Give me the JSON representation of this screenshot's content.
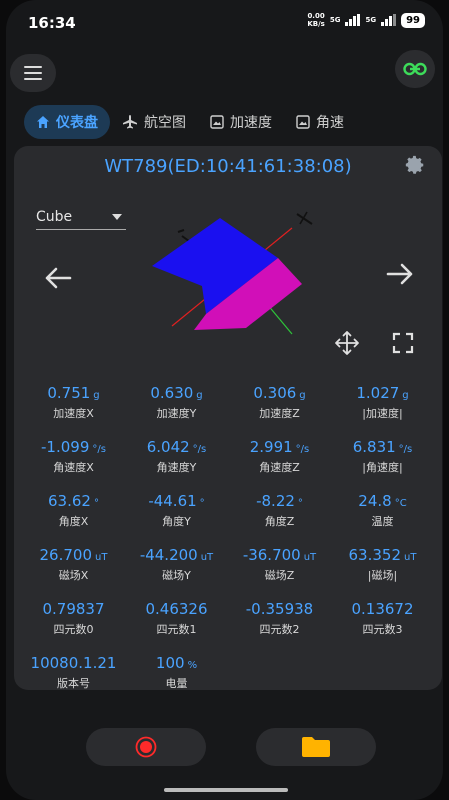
{
  "status": {
    "time": "16:34",
    "speed": "0.00",
    "speed_unit": "KB/s",
    "sig1": "5G",
    "sig2": "5G",
    "battery": "99"
  },
  "tabs": [
    {
      "label": "仪表盘",
      "icon": "home-icon",
      "active": true
    },
    {
      "label": "航空图",
      "icon": "airplane-icon",
      "active": false
    },
    {
      "label": "加速度",
      "icon": "image-icon",
      "active": false
    },
    {
      "label": "角速",
      "icon": "image-icon",
      "active": false
    }
  ],
  "device": {
    "title": "WT789(ED:10:41:61:38:08)"
  },
  "view_select": {
    "value": "Cube"
  },
  "colors": {
    "accent": "#4aa3ff",
    "cube_top": "#1a10f0",
    "cube_side": "#d10fb8",
    "record": "#ff2a2a",
    "folder": "#ffb300"
  },
  "readings": [
    {
      "value": "0.751",
      "unit": "g",
      "label": "加速度X"
    },
    {
      "value": "0.630",
      "unit": "g",
      "label": "加速度Y"
    },
    {
      "value": "0.306",
      "unit": "g",
      "label": "加速度Z"
    },
    {
      "value": "1.027",
      "unit": "g",
      "label": "|加速度|"
    },
    {
      "value": "-1.099",
      "unit": "°/s",
      "label": "角速度X"
    },
    {
      "value": "6.042",
      "unit": "°/s",
      "label": "角速度Y"
    },
    {
      "value": "2.991",
      "unit": "°/s",
      "label": "角速度Z"
    },
    {
      "value": "6.831",
      "unit": "°/s",
      "label": "|角速度|"
    },
    {
      "value": "63.62",
      "unit": "°",
      "label": "角度X"
    },
    {
      "value": "-44.61",
      "unit": "°",
      "label": "角度Y"
    },
    {
      "value": "-8.22",
      "unit": "°",
      "label": "角度Z"
    },
    {
      "value": "24.8",
      "unit": "°C",
      "label": "温度"
    },
    {
      "value": "26.700",
      "unit": "uT",
      "label": "磁场X"
    },
    {
      "value": "-44.200",
      "unit": "uT",
      "label": "磁场Y"
    },
    {
      "value": "-36.700",
      "unit": "uT",
      "label": "磁场Z"
    },
    {
      "value": "63.352",
      "unit": "uT",
      "label": "|磁场|"
    },
    {
      "value": "0.79837",
      "unit": "",
      "label": "四元数0"
    },
    {
      "value": "0.46326",
      "unit": "",
      "label": "四元数1"
    },
    {
      "value": "-0.35938",
      "unit": "",
      "label": "四元数2"
    },
    {
      "value": "0.13672",
      "unit": "",
      "label": "四元数3"
    },
    {
      "value": "10080.1.21",
      "unit": "",
      "label": "版本号"
    },
    {
      "value": "100",
      "unit": "%",
      "label": "电量"
    }
  ]
}
